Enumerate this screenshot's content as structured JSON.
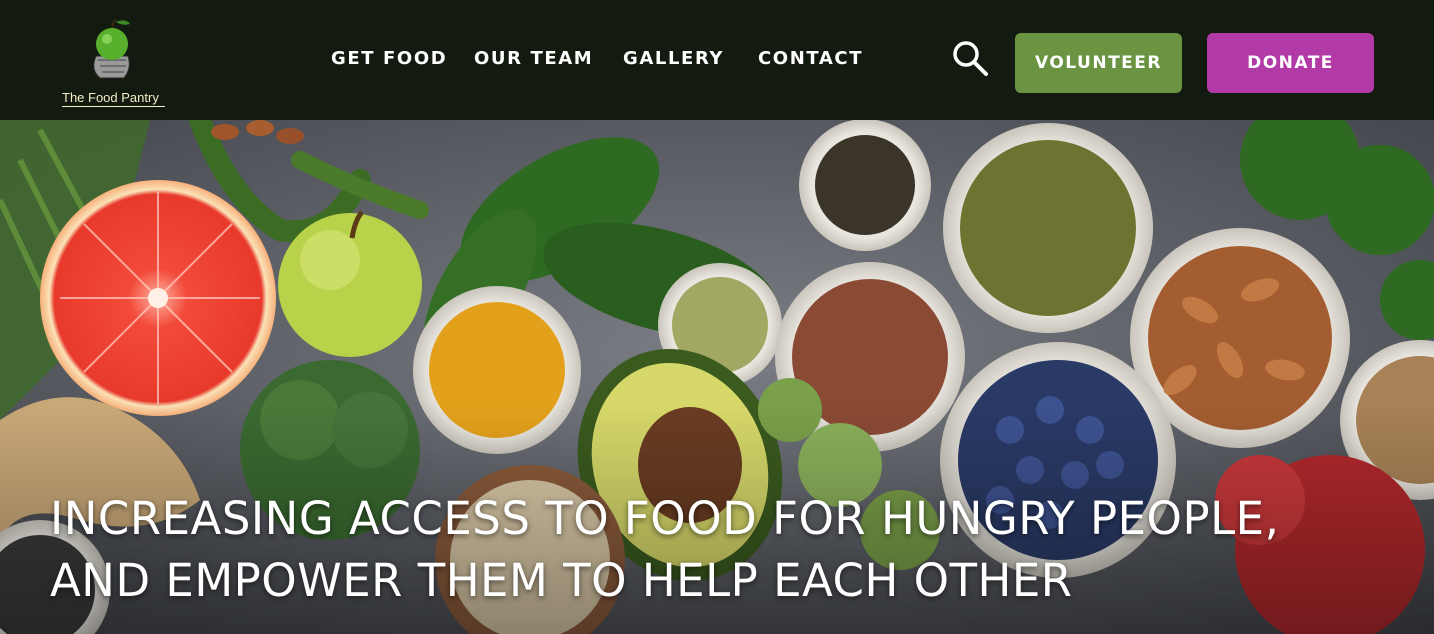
{
  "header": {
    "logo_text": "The Food Pantry",
    "nav": [
      {
        "label": "GET FOOD"
      },
      {
        "label": "OUR TEAM"
      },
      {
        "label": "GALLERY"
      },
      {
        "label": "CONTACT"
      }
    ],
    "search_icon": "search-icon",
    "volunteer_label": "VOLUNTEER",
    "donate_label": "DONATE"
  },
  "hero": {
    "headline_line1": "INCREASING ACCESS TO FOOD FOR HUNGRY PEOPLE,",
    "headline_line2": "AND EMPOWER THEM TO HELP EACH OTHER"
  },
  "colors": {
    "header_bg": "#131a10",
    "volunteer": "#6a9442",
    "donate": "#b23aa6"
  }
}
